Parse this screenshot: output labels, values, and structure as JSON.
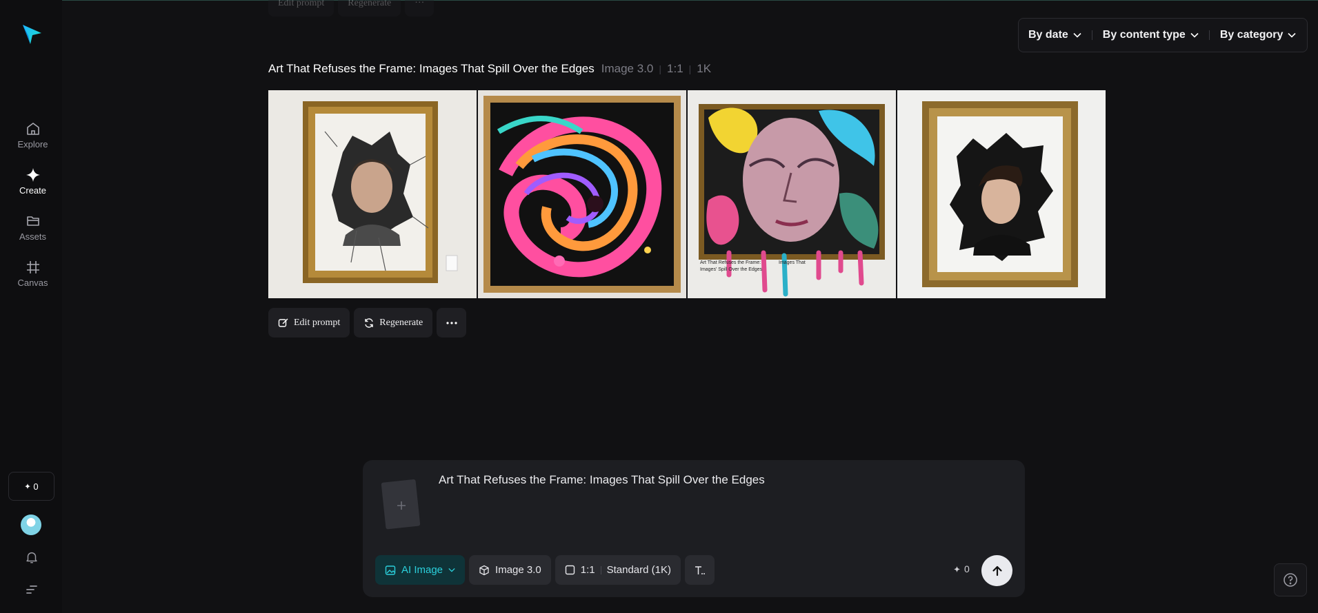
{
  "nav": {
    "items": [
      {
        "label": "Explore",
        "icon": "home-icon"
      },
      {
        "label": "Create",
        "icon": "sparkle-icon"
      },
      {
        "label": "Assets",
        "icon": "folder-icon"
      },
      {
        "label": "Canvas",
        "icon": "frame-icon"
      }
    ],
    "credits": "0"
  },
  "ghost": {
    "edit_label": "Edit prompt",
    "regen_label": "Regenerate"
  },
  "filters": {
    "date": "By date",
    "content_type": "By content type",
    "category": "By category"
  },
  "generation": {
    "title": "Art That Refuses the Frame: Images That Spill Over the Edges",
    "model": "Image 3.0",
    "ratio": "1:1",
    "resolution": "1K",
    "overlay_text_left": "Art That Refuses the Frame: Images' Spill Over the Edges",
    "overlay_text_right": "Images That"
  },
  "actions": {
    "edit_label": "Edit prompt",
    "regen_label": "Regenerate"
  },
  "composer": {
    "prompt": "Art That Refuses the Frame: Images That Spill Over the Edges",
    "mode_label": "AI Image",
    "model_label": "Image 3.0",
    "ratio_label": "1:1",
    "quality_label": "Standard (1K)",
    "cost": "0"
  },
  "colors": {
    "accent": "#2bd0dc",
    "background": "#111113",
    "panel": "#1d1e22"
  }
}
